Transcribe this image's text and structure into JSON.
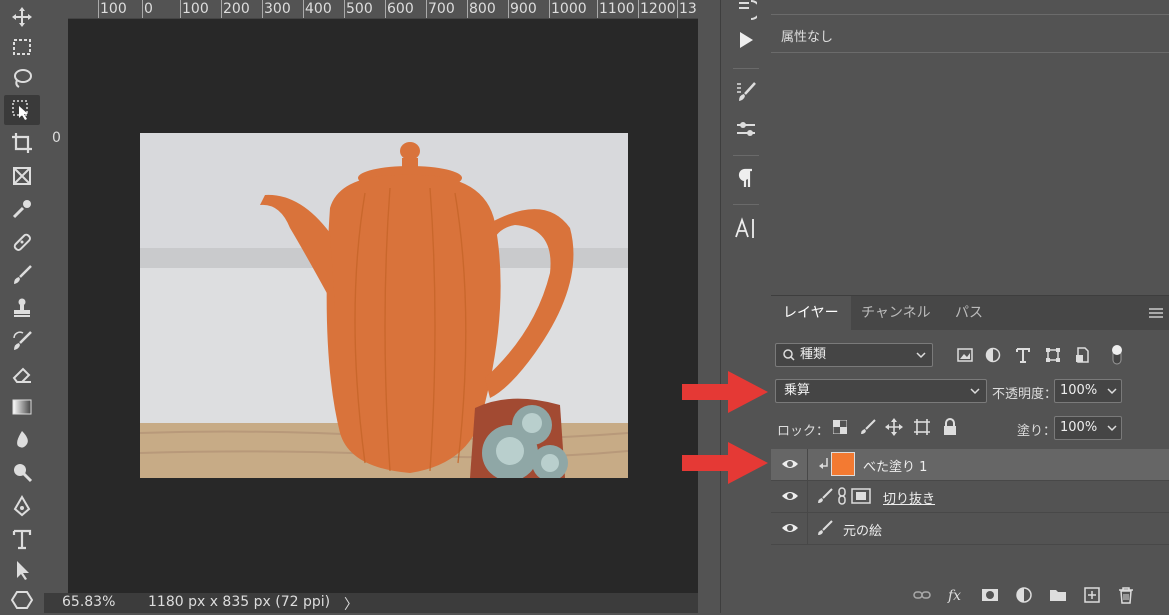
{
  "ruler": {
    "top_ticks": [
      "100",
      "0",
      "100",
      "200",
      "300",
      "400",
      "500",
      "600",
      "700",
      "800",
      "900",
      "1000",
      "1100",
      "1200",
      "13"
    ],
    "left_tick": "0"
  },
  "status": {
    "zoom": "65.83%",
    "dimensions": "1180 px x 835 px (72 ppi)",
    "arrow": "〉"
  },
  "properties": {
    "label": "属性なし"
  },
  "layers_panel": {
    "tabs": [
      "レイヤー",
      "チャンネル",
      "パス"
    ],
    "filter_label": "種類",
    "blend_mode": "乗算",
    "opacity_label": "不透明度：",
    "opacity_value": "100%",
    "lock_label": "ロック：",
    "fill_label": "塗り：",
    "fill_value": "100%",
    "layers": [
      {
        "name": "べた塗り 1",
        "selected": true,
        "swatch_color": "#f37a32"
      },
      {
        "name": "切り抜き",
        "selected": false
      },
      {
        "name": "元の絵",
        "selected": false
      }
    ]
  },
  "colors": {
    "accent_arrow": "#e53935",
    "fill_swatch": "#f37a32",
    "teapot": "#d9733b"
  }
}
